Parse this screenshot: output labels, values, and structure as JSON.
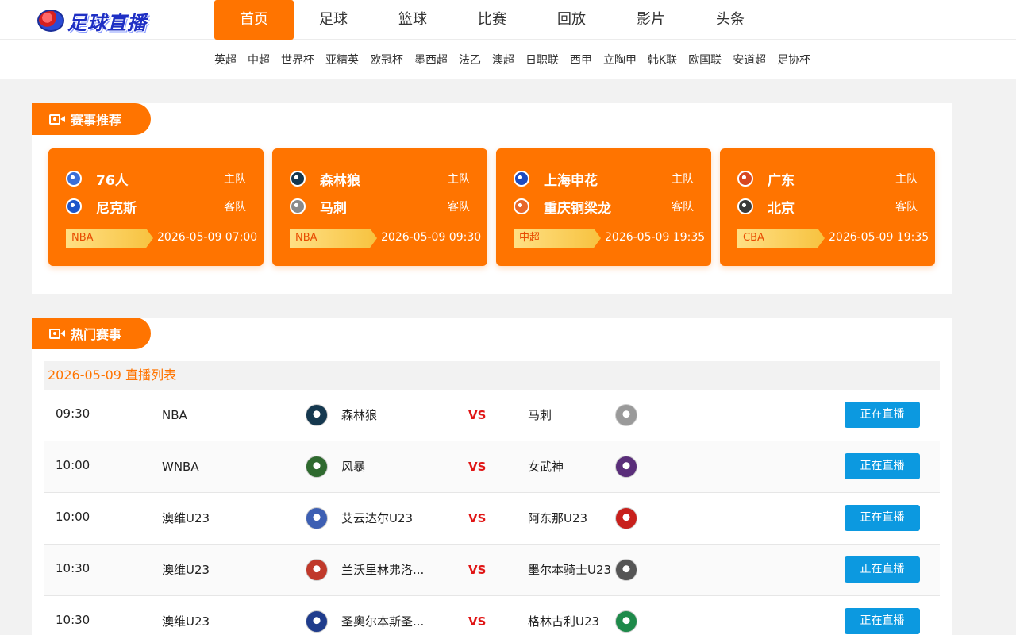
{
  "logo": {
    "text": "足球直播",
    "icon": "soccer-ball-icon"
  },
  "main_nav": [
    {
      "label": "首页",
      "active": true
    },
    {
      "label": "足球"
    },
    {
      "label": "篮球"
    },
    {
      "label": "比赛"
    },
    {
      "label": "回放"
    },
    {
      "label": "影片"
    },
    {
      "label": "头条"
    }
  ],
  "sub_nav": [
    "英超",
    "中超",
    "世界杯",
    "亚精英",
    "欧冠杯",
    "墨西超",
    "法乙",
    "澳超",
    "日职联",
    "西甲",
    "立陶甲",
    "韩K联",
    "欧国联",
    "安道超",
    "足协杯"
  ],
  "colors": {
    "accent": "#ff7400",
    "live_button": "#0c99e0",
    "vs": "#e01515"
  },
  "recommend": {
    "title": "赛事推荐",
    "icon": "video-camera-icon",
    "cards": [
      {
        "home": "76人",
        "home_side": "主队",
        "away": "尼克斯",
        "away_side": "客队",
        "league": "NBA",
        "time": "2026-05-09 07:00",
        "home_color": "#3a6fd8",
        "away_color": "#1d55c9"
      },
      {
        "home": "森林狼",
        "home_side": "主队",
        "away": "马刺",
        "away_side": "客队",
        "league": "NBA",
        "time": "2026-05-09 09:30",
        "home_color": "#15384f",
        "away_color": "#8a8a8a"
      },
      {
        "home": "上海申花",
        "home_side": "主队",
        "away": "重庆铜梁龙",
        "away_side": "客队",
        "league": "中超",
        "time": "2026-05-09 19:35",
        "home_color": "#1d4bbf",
        "away_color": "#e8672a"
      },
      {
        "home": "广东",
        "home_side": "主队",
        "away": "北京",
        "away_side": "客队",
        "league": "CBA",
        "time": "2026-05-09 19:35",
        "home_color": "#d8481f",
        "away_color": "#3a3a3a"
      }
    ]
  },
  "hot": {
    "title": "热门赛事",
    "icon": "video-camera-icon",
    "list_heading": "2026-05-09 直播列表",
    "vs_label": "VS",
    "live_label": "正在直播",
    "matches": [
      {
        "time": "09:30",
        "league": "NBA",
        "home": "森林狼",
        "away": "马刺",
        "home_color": "#15384f",
        "away_color": "#9a9a9a"
      },
      {
        "time": "10:00",
        "league": "WNBA",
        "home": "风暴",
        "away": "女武神",
        "home_color": "#2f6a2f",
        "away_color": "#5a2e7a"
      },
      {
        "time": "10:00",
        "league": "澳维U23",
        "home": "艾云达尔U23",
        "away": "阿东那U23",
        "home_color": "#3d5fb3",
        "away_color": "#c8201c"
      },
      {
        "time": "10:30",
        "league": "澳维U23",
        "home": "兰沃里林弗洛...",
        "away": "墨尔本骑士U23",
        "home_color": "#c0392b",
        "away_color": "#555555"
      },
      {
        "time": "10:30",
        "league": "澳维U23",
        "home": "圣奥尔本斯圣...",
        "away": "格林古利U23",
        "home_color": "#1f3c8c",
        "away_color": "#1e8a4a"
      }
    ]
  }
}
